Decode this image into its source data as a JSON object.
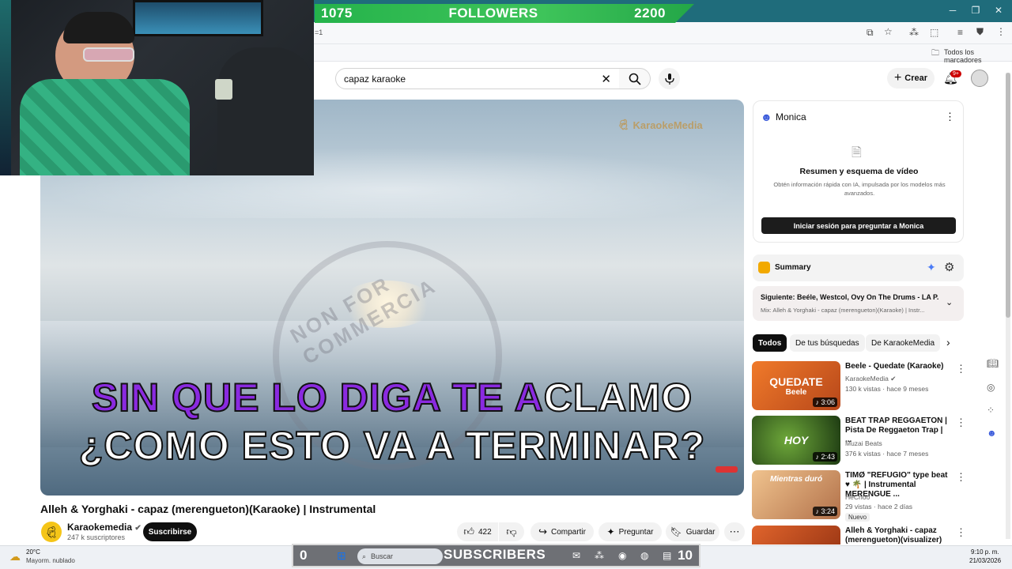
{
  "overlay": {
    "followers_left": "1075",
    "followers_label": "FOLLOWERS",
    "followers_right": "2200",
    "subs_left": "0",
    "subs_label": "SUBSCRIBERS",
    "subs_right": "10"
  },
  "browser": {
    "address_fragment": "=1",
    "bookmarks_label": "Todos los marcadores"
  },
  "youtube": {
    "search_value": "capaz karaoke",
    "create_label": "Crear",
    "notif_count": "9+"
  },
  "video": {
    "watermark_logo": "KaraokeMedia",
    "watermark_ring_text": "NON FOR COMMERCIA",
    "lyric1_sung": "SIN QUE LO DIGA TE A",
    "lyric1_rest": "CLAMO",
    "lyric2": "¿COMO ESTO VA A TERMINAR?",
    "title": "Alleh & Yorghaki - capaz (merengueton)(Karaoke) | Instrumental",
    "channel": "Karaokemedia",
    "channel_subs": "247 k suscriptores",
    "subscribe": "Suscribirse",
    "likes": "422",
    "share": "Compartir",
    "ask": "Preguntar",
    "save": "Guardar"
  },
  "monica": {
    "name": "Monica",
    "heading": "Resumen y esquema de vídeo",
    "desc": "Obtén información rápida con IA, impulsada por los modelos más avanzados.",
    "login_button": "Iniciar sesión para preguntar a Monica"
  },
  "summary": {
    "label": "Summary"
  },
  "next": {
    "title": "Siguiente: Beéle, Westcol, Ovy On The Drums - LA P...",
    "sub": "Mix: Alleh & Yorghaki - capaz (merengueton)(Karaoke) | Instr..."
  },
  "chips": [
    "Todos",
    "De tus búsquedas",
    "De KaraokeMedia"
  ],
  "recs": [
    {
      "title": "Beele - Quedate (Karaoke)",
      "channel": "KaraokeMedia",
      "meta": "130 k vistas · hace 9 meses",
      "duration": "3:06",
      "thumb_text": "QUEDATE",
      "thumb_sub": "Beele",
      "thumb_color": "#e0621e"
    },
    {
      "title": "BEAT TRAP REGGAETON  | Pista De Reggaeton Trap | ...",
      "channel": "Muzai Beats",
      "meta": "376 k vistas · hace 7 meses",
      "duration": "2:43",
      "thumb_text": "HOY",
      "thumb_sub": "",
      "thumb_color": "#2d5a1f"
    },
    {
      "title": "TIMØ \"REFUGIO\" type beat ♥ 🌴 | Instrumental MERENGUE ...",
      "channel": "HeChoo",
      "meta": "29 vistas · hace 2 días",
      "badge": "Nuevo",
      "duration": "3:24",
      "thumb_text": "Mientras duró",
      "thumb_sub": "",
      "thumb_color": "#c98b5a"
    },
    {
      "title": "Alleh & Yorghaki - capaz (merengueton)(visualizer)",
      "channel": "",
      "meta": "",
      "duration": "",
      "thumb_text": "",
      "thumb_sub": "",
      "thumb_color": "#d9622a"
    }
  ],
  "taskbar": {
    "weather_temp": "20°C",
    "weather_desc": "Mayorm. nublado",
    "search_placeholder": "Buscar",
    "time": "9:10 p. m.",
    "date": "21/03/2026"
  }
}
